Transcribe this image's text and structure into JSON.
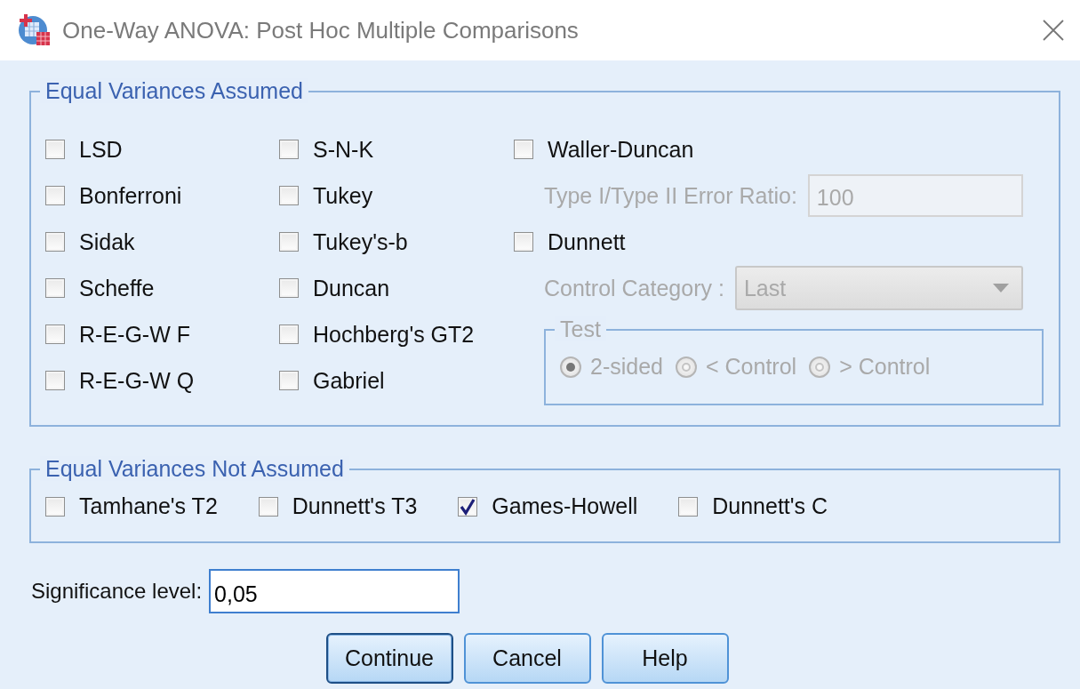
{
  "window": {
    "title": "One-Way ANOVA: Post Hoc Multiple Comparisons"
  },
  "equal_variances_assumed": {
    "title": "Equal Variances Assumed",
    "column_1": [
      {
        "label": "LSD",
        "checked": false
      },
      {
        "label": "Bonferroni",
        "checked": false
      },
      {
        "label": "Sidak",
        "checked": false
      },
      {
        "label": "Scheffe",
        "checked": false
      },
      {
        "label": "R-E-G-W F",
        "checked": false
      },
      {
        "label": "R-E-G-W Q",
        "checked": false
      }
    ],
    "column_2": [
      {
        "label": "S-N-K",
        "checked": false
      },
      {
        "label": "Tukey",
        "checked": false
      },
      {
        "label": "Tukey's-b",
        "checked": false
      },
      {
        "label": "Duncan",
        "checked": false
      },
      {
        "label": "Hochberg's GT2",
        "checked": false
      },
      {
        "label": "Gabriel",
        "checked": false
      }
    ],
    "column_3": [
      {
        "kind": "checkbox",
        "label": "Waller-Duncan",
        "checked": false
      },
      {
        "kind": "field",
        "label": "Type I/Type II Error Ratio:",
        "value": "100",
        "disabled": true
      },
      {
        "kind": "checkbox",
        "label": "Dunnett",
        "checked": false
      },
      {
        "kind": "dropdown",
        "label": "Control Category :",
        "value": "Last",
        "disabled": true
      },
      {
        "kind": "radio_group",
        "title": "Test",
        "disabled": true,
        "options": [
          {
            "label": "2-sided",
            "selected": true
          },
          {
            "label": "< Control",
            "selected": false
          },
          {
            "label": "> Control",
            "selected": false
          }
        ]
      }
    ]
  },
  "equal_variances_not_assumed": {
    "title": "Equal Variances Not Assumed",
    "options": [
      {
        "label": "Tamhane's T2",
        "checked": false
      },
      {
        "label": "Dunnett's T3",
        "checked": false
      },
      {
        "label": "Games-Howell",
        "checked": true
      },
      {
        "label": "Dunnett's C",
        "checked": false
      }
    ]
  },
  "significance_level": {
    "label": "Significance level:",
    "value": "0,05"
  },
  "buttons": [
    {
      "label": "Continue",
      "focused": true
    },
    {
      "label": "Cancel",
      "focused": false
    },
    {
      "label": "Help",
      "focused": false
    }
  ]
}
